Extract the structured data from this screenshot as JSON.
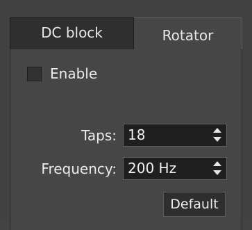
{
  "tabs": [
    {
      "label": "DC block",
      "active": false
    },
    {
      "label": "Rotator",
      "active": true
    }
  ],
  "enable": {
    "label": "Enable",
    "checked": false
  },
  "taps": {
    "label": "Taps:",
    "value": "18"
  },
  "frequency": {
    "label": "Frequency:",
    "value": "200 Hz"
  },
  "default_button": {
    "label": "Default"
  },
  "colors": {
    "background": "#434343",
    "panel": "#464646",
    "input_bg": "#1f1f1f",
    "text": "#ececec"
  }
}
